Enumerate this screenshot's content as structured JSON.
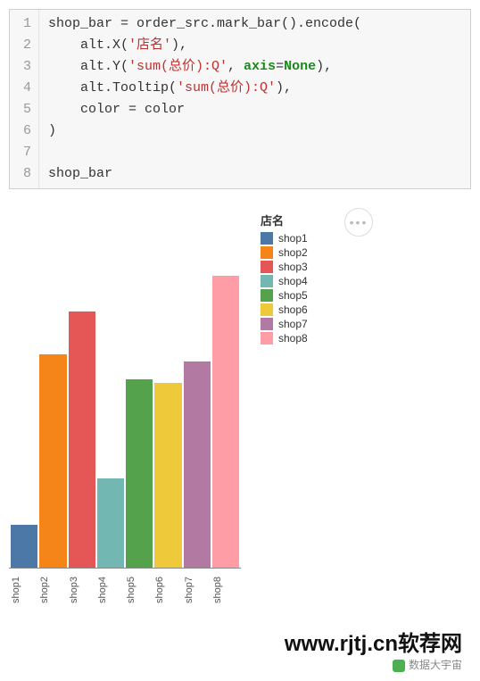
{
  "code": {
    "lines": [
      [
        {
          "t": "shop_bar = order_src.mark_bar().encode("
        }
      ],
      [
        {
          "t": "    alt.X("
        },
        {
          "t": "'店名'",
          "cls": "str"
        },
        {
          "t": "),"
        }
      ],
      [
        {
          "t": "    alt.Y("
        },
        {
          "t": "'sum(总价):Q'",
          "cls": "str"
        },
        {
          "t": ", "
        },
        {
          "t": "axis",
          "cls": "kwarg"
        },
        {
          "t": "="
        },
        {
          "t": "None",
          "cls": "kwarg"
        },
        {
          "t": "),"
        }
      ],
      [
        {
          "t": "    alt.Tooltip("
        },
        {
          "t": "'sum(总价):Q'",
          "cls": "str"
        },
        {
          "t": "),"
        }
      ],
      [
        {
          "t": "    color = color"
        }
      ],
      [
        {
          "t": ")"
        }
      ],
      [
        {
          "t": ""
        }
      ],
      [
        {
          "t": "shop_bar"
        }
      ]
    ]
  },
  "chart_data": {
    "type": "bar",
    "title": "",
    "xlabel": "",
    "ylabel": "",
    "grid": false,
    "categories": [
      "shop1",
      "shop2",
      "shop3",
      "shop4",
      "shop5",
      "shop6",
      "shop7",
      "shop8"
    ],
    "values": [
      12,
      60,
      72,
      25,
      53,
      52,
      58,
      82
    ],
    "colors": [
      "#4c78a8",
      "#f58518",
      "#e45756",
      "#72b7b2",
      "#54a24b",
      "#eeca3b",
      "#b279a2",
      "#ff9da6"
    ],
    "ylim": [
      0,
      100
    ],
    "legend": {
      "title": "店名",
      "position": "right",
      "items": [
        {
          "label": "shop1",
          "color": "#4c78a8"
        },
        {
          "label": "shop2",
          "color": "#f58518"
        },
        {
          "label": "shop3",
          "color": "#e45756"
        },
        {
          "label": "shop4",
          "color": "#72b7b2"
        },
        {
          "label": "shop5",
          "color": "#54a24b"
        },
        {
          "label": "shop6",
          "color": "#eeca3b"
        },
        {
          "label": "shop7",
          "color": "#b279a2"
        },
        {
          "label": "shop8",
          "color": "#ff9da6"
        }
      ]
    }
  },
  "menu_icon": "•••",
  "watermark": {
    "main": "www.rjtj.cn软荐网",
    "sub": "数据大宇宙"
  }
}
